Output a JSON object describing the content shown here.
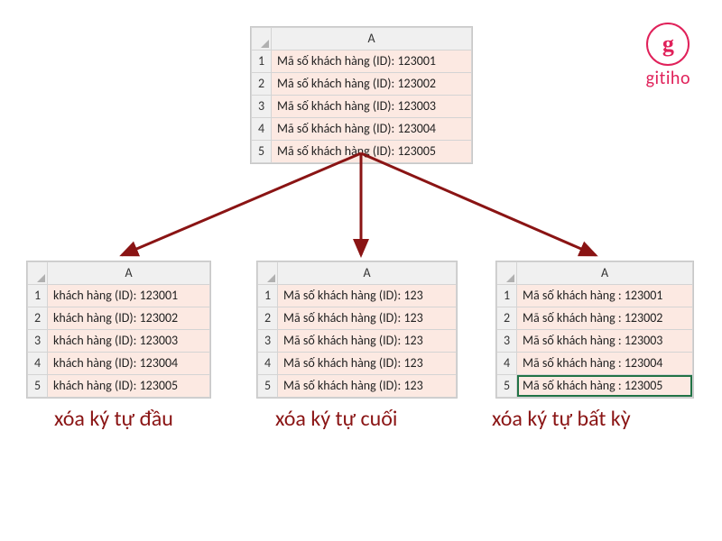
{
  "brand": {
    "logo_text": "gitiho",
    "logo_glyph": "g"
  },
  "colors": {
    "accent": "#8a1414",
    "brand": "#e0215a",
    "cell_bg": "#fce9e2"
  },
  "top_sheet": {
    "column": "A",
    "rows": [
      {
        "n": "1",
        "v": "Mã số khách hàng (ID): 123001"
      },
      {
        "n": "2",
        "v": "Mã số khách hàng (ID): 123002"
      },
      {
        "n": "3",
        "v": "Mã số khách hàng (ID): 123003"
      },
      {
        "n": "4",
        "v": "Mã số khách hàng (ID): 123004"
      },
      {
        "n": "5",
        "v": "Mã số khách hàng (ID): 123005"
      }
    ]
  },
  "left_sheet": {
    "column": "A",
    "caption": "xóa ký tự đầu",
    "rows": [
      {
        "n": "1",
        "v": "khách hàng (ID): 123001"
      },
      {
        "n": "2",
        "v": "khách hàng (ID): 123002"
      },
      {
        "n": "3",
        "v": "khách hàng (ID): 123003"
      },
      {
        "n": "4",
        "v": "khách hàng (ID): 123004"
      },
      {
        "n": "5",
        "v": "khách hàng (ID): 123005"
      }
    ]
  },
  "mid_sheet": {
    "column": "A",
    "caption": "xóa ký tự cuối",
    "rows": [
      {
        "n": "1",
        "v": "Mã số khách hàng (ID): 123"
      },
      {
        "n": "2",
        "v": "Mã số khách hàng (ID): 123"
      },
      {
        "n": "3",
        "v": "Mã số khách hàng (ID): 123"
      },
      {
        "n": "4",
        "v": "Mã số khách hàng (ID): 123"
      },
      {
        "n": "5",
        "v": "Mã số khách hàng (ID): 123"
      }
    ]
  },
  "right_sheet": {
    "column": "A",
    "caption": "xóa ký tự bất kỳ",
    "rows": [
      {
        "n": "1",
        "v": "Mã số khách hàng : 123001"
      },
      {
        "n": "2",
        "v": "Mã số khách hàng : 123002"
      },
      {
        "n": "3",
        "v": "Mã số khách hàng : 123003"
      },
      {
        "n": "4",
        "v": "Mã số khách hàng : 123004"
      },
      {
        "n": "5",
        "v": "Mã số khách hàng : 123005"
      }
    ]
  }
}
